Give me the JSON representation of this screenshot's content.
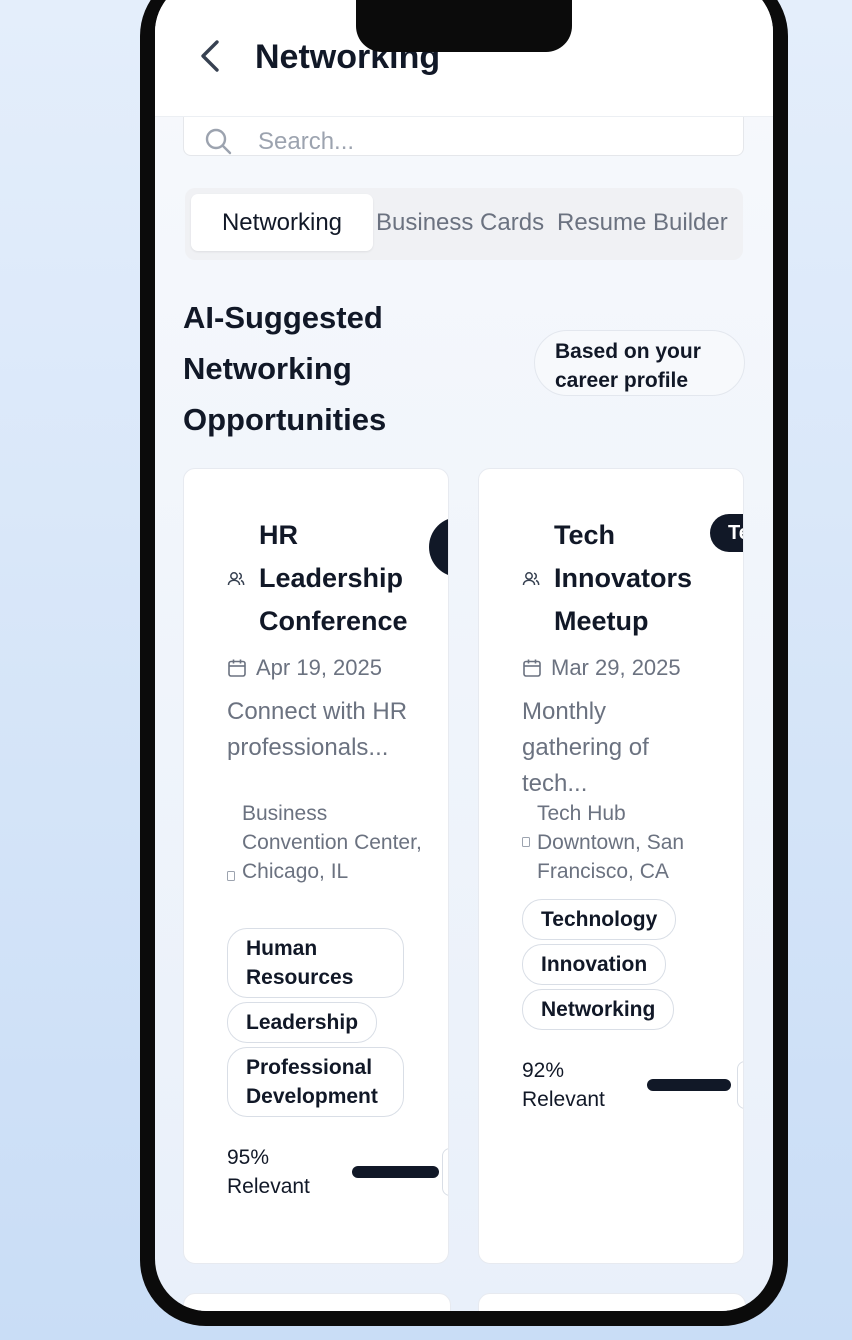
{
  "header": {
    "title": "Networking"
  },
  "search": {
    "placeholder": "Search..."
  },
  "tabs": [
    {
      "label": "Networking",
      "active": true
    },
    {
      "label": "Business Cards",
      "active": false
    },
    {
      "label": "Resume Builder",
      "active": false
    }
  ],
  "section": {
    "title": "AI-Suggested Networking Opportunities",
    "badge": "Based on your career profile"
  },
  "events": [
    {
      "title": "HR Leadership Conference",
      "date": "Apr 19, 2025",
      "description": "Connect with HR professionals...",
      "location": "Business Convention Center, Chicago, IL",
      "tags": [
        "Human Resources",
        "Leadership",
        "Professional Development"
      ],
      "relevance": "95% Relevant",
      "relevance_value": 95,
      "badge": ""
    },
    {
      "title": "Tech Innovators Meetup",
      "date": "Mar 29, 2025",
      "description": "Monthly gathering of tech...",
      "location": "Tech Hub Downtown, San Francisco, CA",
      "tags": [
        "Technology",
        "Innovation",
        "Networking"
      ],
      "relevance": "92% Relevant",
      "relevance_value": 92,
      "badge": "Te"
    }
  ],
  "colors": {
    "primary": "#111827",
    "muted_text": "#6b7280",
    "background_top": "#e4eefb",
    "background_bottom": "#c9ddf6"
  }
}
